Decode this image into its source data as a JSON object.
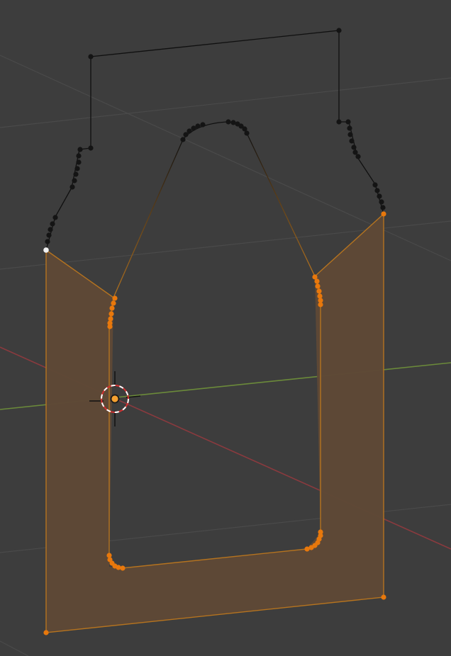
{
  "viewport": {
    "name": "3d-viewport",
    "mode": "edit-mode",
    "background_color": "#3d3d3d"
  },
  "colors": {
    "grid_line": "#4a4a4a",
    "x_axis": "#8a3a3e",
    "y_axis": "#6b8a3a",
    "selected_fill": "#5e4836",
    "selected_edge": "#b5731f",
    "selected_vertex": "#e8780c",
    "unselected_edge": "#101010",
    "unselected_vertex": "#141414",
    "active_vertex": "#f2f2f2",
    "cursor_ring_red": "#d43030",
    "cursor_ring_white": "#ffffff",
    "origin_dot": "#f5a030"
  },
  "icons": {
    "cursor": "3d-cursor-icon",
    "origin": "object-origin-icon"
  }
}
